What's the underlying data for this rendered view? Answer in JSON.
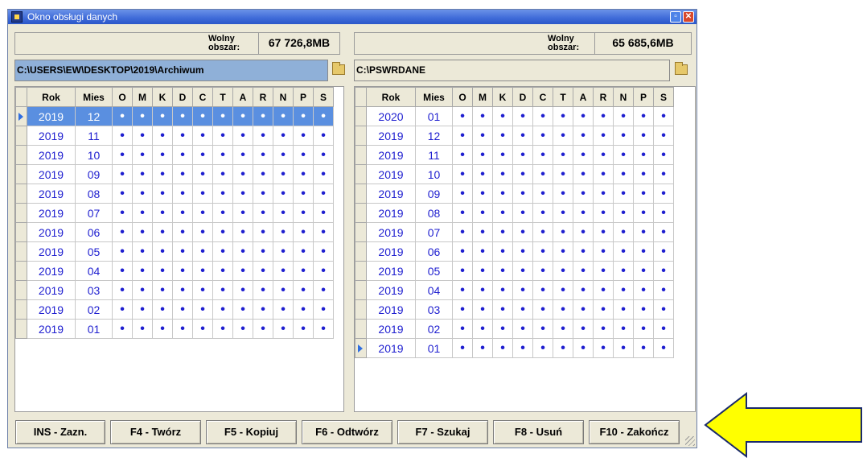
{
  "window": {
    "title": "Okno obsługi danych"
  },
  "left": {
    "free_label": "Wolny obszar:",
    "free_value": "67 726,8MB",
    "path": "C:\\USERS\\EW\\DESKTOP\\2019\\Archiwum"
  },
  "right": {
    "free_label": "Wolny obszar:",
    "free_value": "65 685,6MB",
    "path": "C:\\PSWRDANE"
  },
  "columns": [
    "Rok",
    "Mies",
    "O",
    "M",
    "K",
    "D",
    "C",
    "T",
    "A",
    "R",
    "N",
    "P",
    "S"
  ],
  "dot": "•",
  "left_rows": [
    [
      "2019",
      "12"
    ],
    [
      "2019",
      "11"
    ],
    [
      "2019",
      "10"
    ],
    [
      "2019",
      "09"
    ],
    [
      "2019",
      "08"
    ],
    [
      "2019",
      "07"
    ],
    [
      "2019",
      "06"
    ],
    [
      "2019",
      "05"
    ],
    [
      "2019",
      "04"
    ],
    [
      "2019",
      "03"
    ],
    [
      "2019",
      "02"
    ],
    [
      "2019",
      "01"
    ]
  ],
  "right_rows": [
    [
      "2020",
      "01"
    ],
    [
      "2019",
      "12"
    ],
    [
      "2019",
      "11"
    ],
    [
      "2019",
      "10"
    ],
    [
      "2019",
      "09"
    ],
    [
      "2019",
      "08"
    ],
    [
      "2019",
      "07"
    ],
    [
      "2019",
      "06"
    ],
    [
      "2019",
      "05"
    ],
    [
      "2019",
      "04"
    ],
    [
      "2019",
      "03"
    ],
    [
      "2019",
      "02"
    ],
    [
      "2019",
      "01"
    ]
  ],
  "left_selected_row": 0,
  "right_current_row": 12,
  "buttons": [
    "INS - Zazn.",
    "F4 - Twórz",
    "F5 - Kopiuj",
    "F6 - Odtwórz",
    "F7 - Szukaj",
    "F8 - Usuń",
    "F10 - Zakończ"
  ],
  "colors": {
    "selection": "#5a8fe0",
    "value_text": "#1f1fd0",
    "arrow": "#ffff00"
  },
  "icons": {
    "folder_button": "folder-open-icon",
    "pointer_arrow": "yellow-left-arrow"
  }
}
